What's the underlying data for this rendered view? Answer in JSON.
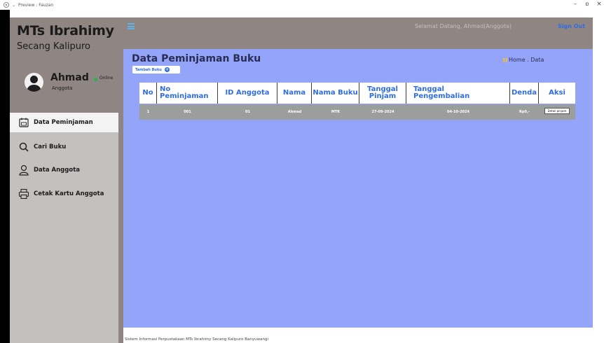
{
  "window": {
    "title": "Preview : Fauzan",
    "controls": [
      "–",
      "🗗",
      "×"
    ]
  },
  "brand": {
    "line1": "MTs Ibrahimy",
    "line2": "Secang Kalipuro"
  },
  "user": {
    "name": "Ahmad",
    "status": "Online",
    "role": "Anggota"
  },
  "menu": [
    {
      "label": "Data Peminjaman",
      "icon": "book-icon",
      "active": true
    },
    {
      "label": "Cari Buku",
      "icon": "search-icon",
      "active": false
    },
    {
      "label": "Data Anggota",
      "icon": "user-icon",
      "active": false
    },
    {
      "label": "Cetak Kartu Anggota",
      "icon": "printer-icon",
      "active": false
    }
  ],
  "header": {
    "welcome": "Selamat Datang, Ahmad(Anggota)",
    "signout": "Sign Out"
  },
  "page": {
    "title": "Data Peminjaman Buku",
    "add_button": "Tambah Buku",
    "breadcrumb": "Home . Data"
  },
  "table": {
    "columns": [
      "No",
      "No Peminjaman",
      "ID Anggota",
      "Nama",
      "Nama Buku",
      "Tanggal Pinjam",
      "Tanggal Pengembalian",
      "Denda",
      "Aksi"
    ],
    "rows": [
      {
        "no": "1",
        "no_peminjaman": "001",
        "id_anggota": "01",
        "nama": "Ahmad",
        "nama_buku": "MTK",
        "tanggal_pinjam": "27-09-2024",
        "tanggal_pengembalian": "04-10-2024",
        "denda": "Rp0,-",
        "aksi": "Detail pinjam"
      }
    ]
  },
  "footer": {
    "text": "Sistem Informasi Perpustakaan MTs Ibrahimy Secang Kalipuro Banyuwangi"
  },
  "colors": {
    "sidebar": "#c4c0bf",
    "topbar": "#8f8583",
    "content": "#94a4f9",
    "accent": "#2f6de0",
    "online": "#27b24a"
  }
}
